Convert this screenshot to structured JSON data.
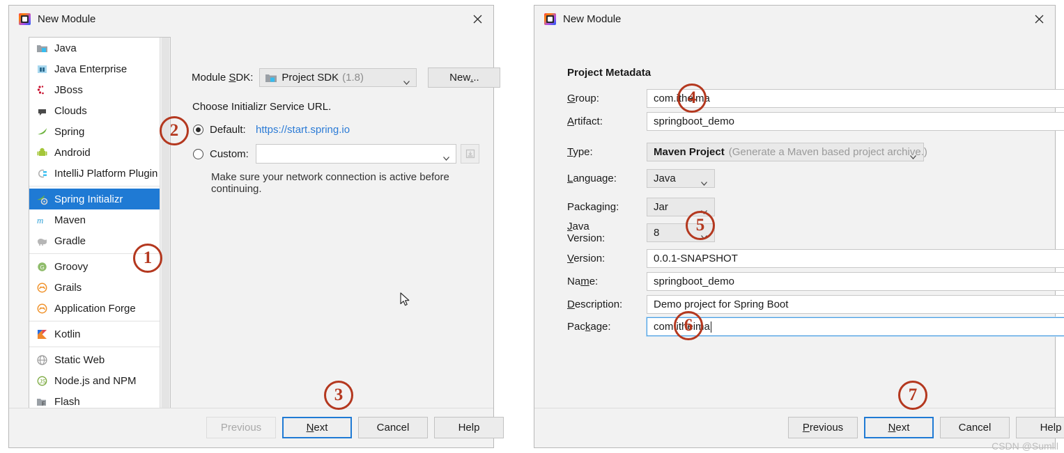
{
  "left_dialog": {
    "title": "New Module",
    "close_icon": "close-icon",
    "categories": [
      {
        "label": "Java",
        "icon": "java-folder-icon",
        "selected": false
      },
      {
        "label": "Java Enterprise",
        "icon": "java-enterprise-icon",
        "selected": false
      },
      {
        "label": "JBoss",
        "icon": "jboss-icon",
        "selected": false
      },
      {
        "label": "Clouds",
        "icon": "clouds-icon",
        "selected": false
      },
      {
        "label": "Spring",
        "icon": "spring-leaf-icon",
        "selected": false
      },
      {
        "label": "Android",
        "icon": "android-icon",
        "selected": false
      },
      {
        "label": "IntelliJ Platform Plugin",
        "icon": "intellij-plugin-icon",
        "selected": false
      },
      {
        "label": "Spring Initializr",
        "icon": "spring-initializr-icon",
        "selected": true
      },
      {
        "label": "Maven",
        "icon": "maven-icon",
        "selected": false
      },
      {
        "label": "Gradle",
        "icon": "gradle-elephant-icon",
        "selected": false
      },
      {
        "label": "Groovy",
        "icon": "groovy-icon",
        "selected": false
      },
      {
        "label": "Grails",
        "icon": "grails-icon",
        "selected": false
      },
      {
        "label": "Application Forge",
        "icon": "application-forge-icon",
        "selected": false
      },
      {
        "label": "Kotlin",
        "icon": "kotlin-icon",
        "selected": false
      },
      {
        "label": "Static Web",
        "icon": "static-web-icon",
        "selected": false
      },
      {
        "label": "Node.js and NPM",
        "icon": "nodejs-icon",
        "selected": false
      },
      {
        "label": "Flash",
        "icon": "flash-icon",
        "selected": false
      }
    ],
    "sdk_label": "Module SDK:",
    "sdk_value": "Project SDK",
    "sdk_version": "(1.8)",
    "new_button": "New...",
    "choose_url_text": "Choose Initializr Service URL.",
    "default_radio_label": "Default:",
    "default_url": "https://start.spring.io",
    "custom_radio_label": "Custom:",
    "custom_value": "",
    "hint": "Make sure your network connection is active before continuing.",
    "footer": {
      "previous": "Previous",
      "next": "Next",
      "cancel": "Cancel",
      "help": "Help"
    }
  },
  "right_dialog": {
    "title": "New Module",
    "close_icon": "close-icon",
    "section_title": "Project Metadata",
    "fields": {
      "group_label": "Group:",
      "group_value": "com.itheima",
      "artifact_label": "Artifact:",
      "artifact_value": "springboot_demo",
      "type_label": "Type:",
      "type_value": "Maven Project",
      "type_hint": "(Generate a Maven based project archive.)",
      "language_label": "Language:",
      "language_value": "Java",
      "packaging_label": "Packaging:",
      "packaging_value": "Jar",
      "java_version_label": "Java Version:",
      "java_version_value": "8",
      "version_label": "Version:",
      "version_value": "0.0.1-SNAPSHOT",
      "name_label": "Name:",
      "name_value": "springboot_demo",
      "description_label": "Description:",
      "description_value": "Demo project for Spring Boot",
      "package_label": "Package:",
      "package_value": "com.itheima"
    },
    "footer": {
      "previous": "Previous",
      "next": "Next",
      "cancel": "Cancel",
      "help": "Help"
    }
  },
  "annotations": [
    {
      "id": "1",
      "label": "1"
    },
    {
      "id": "2",
      "label": "2"
    },
    {
      "id": "3",
      "label": "3"
    },
    {
      "id": "4",
      "label": "4"
    },
    {
      "id": "5",
      "label": "5"
    },
    {
      "id": "6",
      "label": "6"
    },
    {
      "id": "7",
      "label": "7"
    }
  ],
  "watermark": "CSDN @Sumlll"
}
